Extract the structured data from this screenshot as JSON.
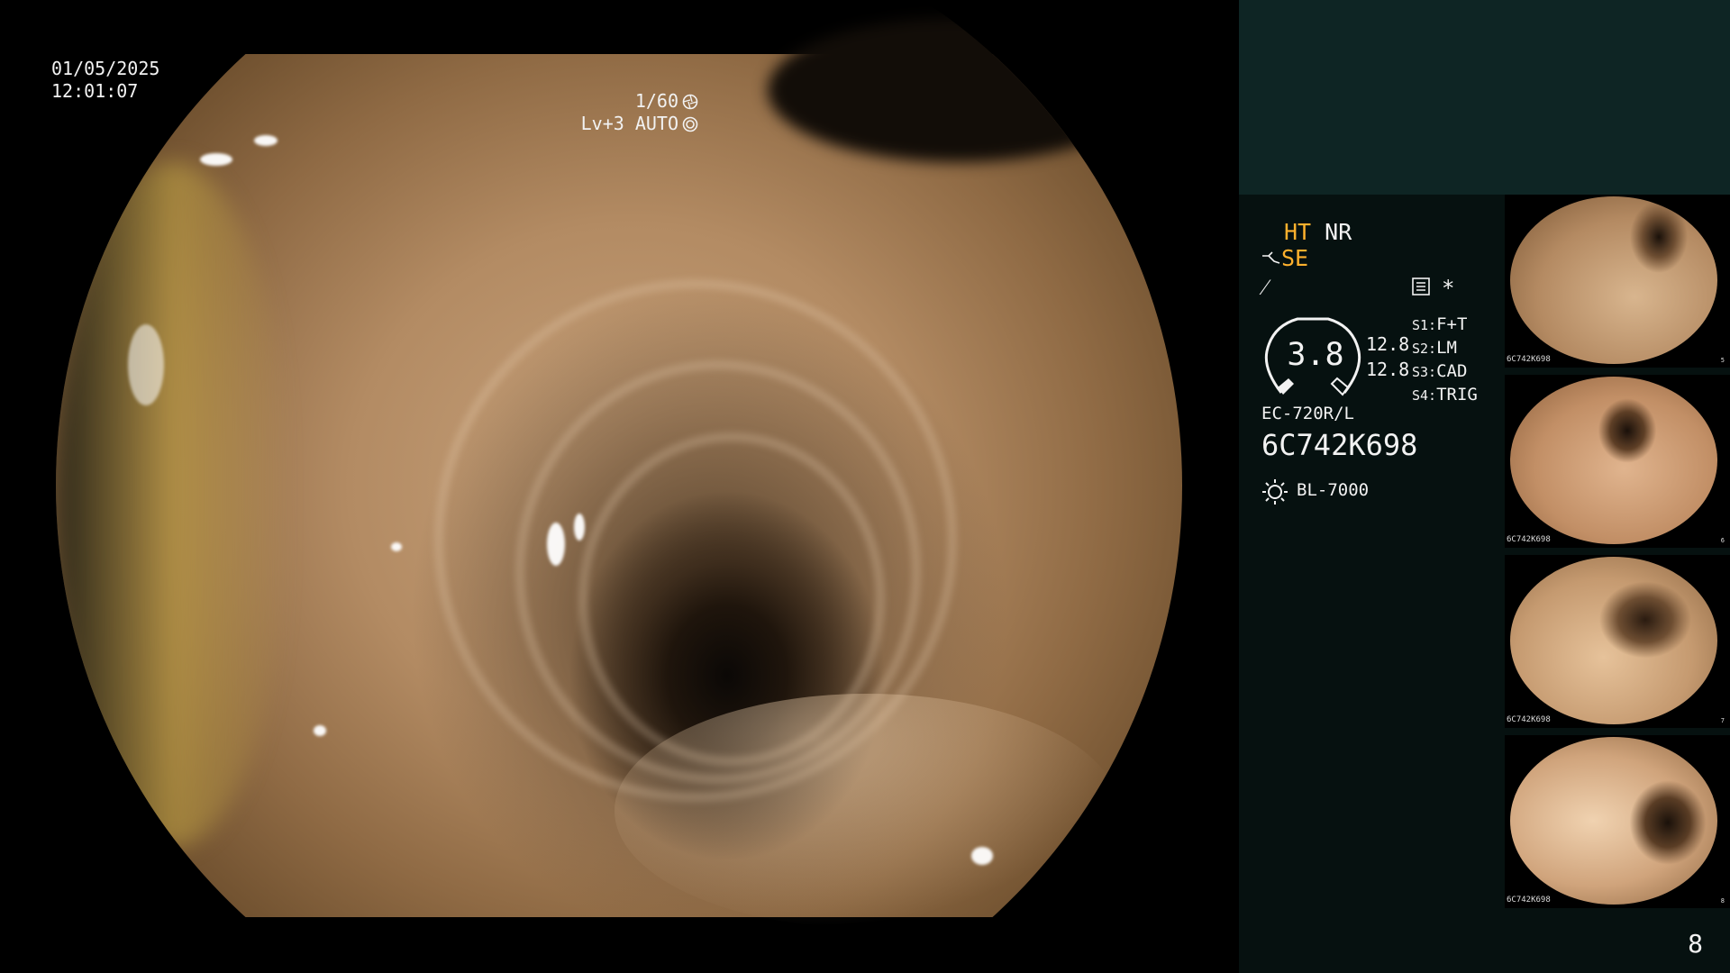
{
  "osd": {
    "date": "01/05/2025",
    "time": "12:01:07",
    "shutter": "1/60",
    "level": "Lv+3 AUTO"
  },
  "panel": {
    "ht": "HT",
    "nr": "NR",
    "se": "SE",
    "f_symbol": "⁄",
    "star": "*",
    "gauge_value": "3.8",
    "value_a": "12.8",
    "value_b": "12.8",
    "s_items": [
      {
        "key": "S1:",
        "val": "F+T"
      },
      {
        "key": "S2:",
        "val": "LM"
      },
      {
        "key": "S3:",
        "val": "CAD"
      },
      {
        "key": "S4:",
        "val": "TRIG"
      }
    ],
    "scope_model": "EC-720R/L",
    "serial": "6C742K698",
    "light_source": "BL-7000",
    "accent_color": "#ffb12d"
  },
  "thumbnails": [
    {
      "label": "6C742K698",
      "index": "5"
    },
    {
      "label": "6C742K698",
      "index": "6"
    },
    {
      "label": "6C742K698",
      "index": "7"
    },
    {
      "label": "6C742K698",
      "index": "8"
    }
  ],
  "page_number": "8"
}
